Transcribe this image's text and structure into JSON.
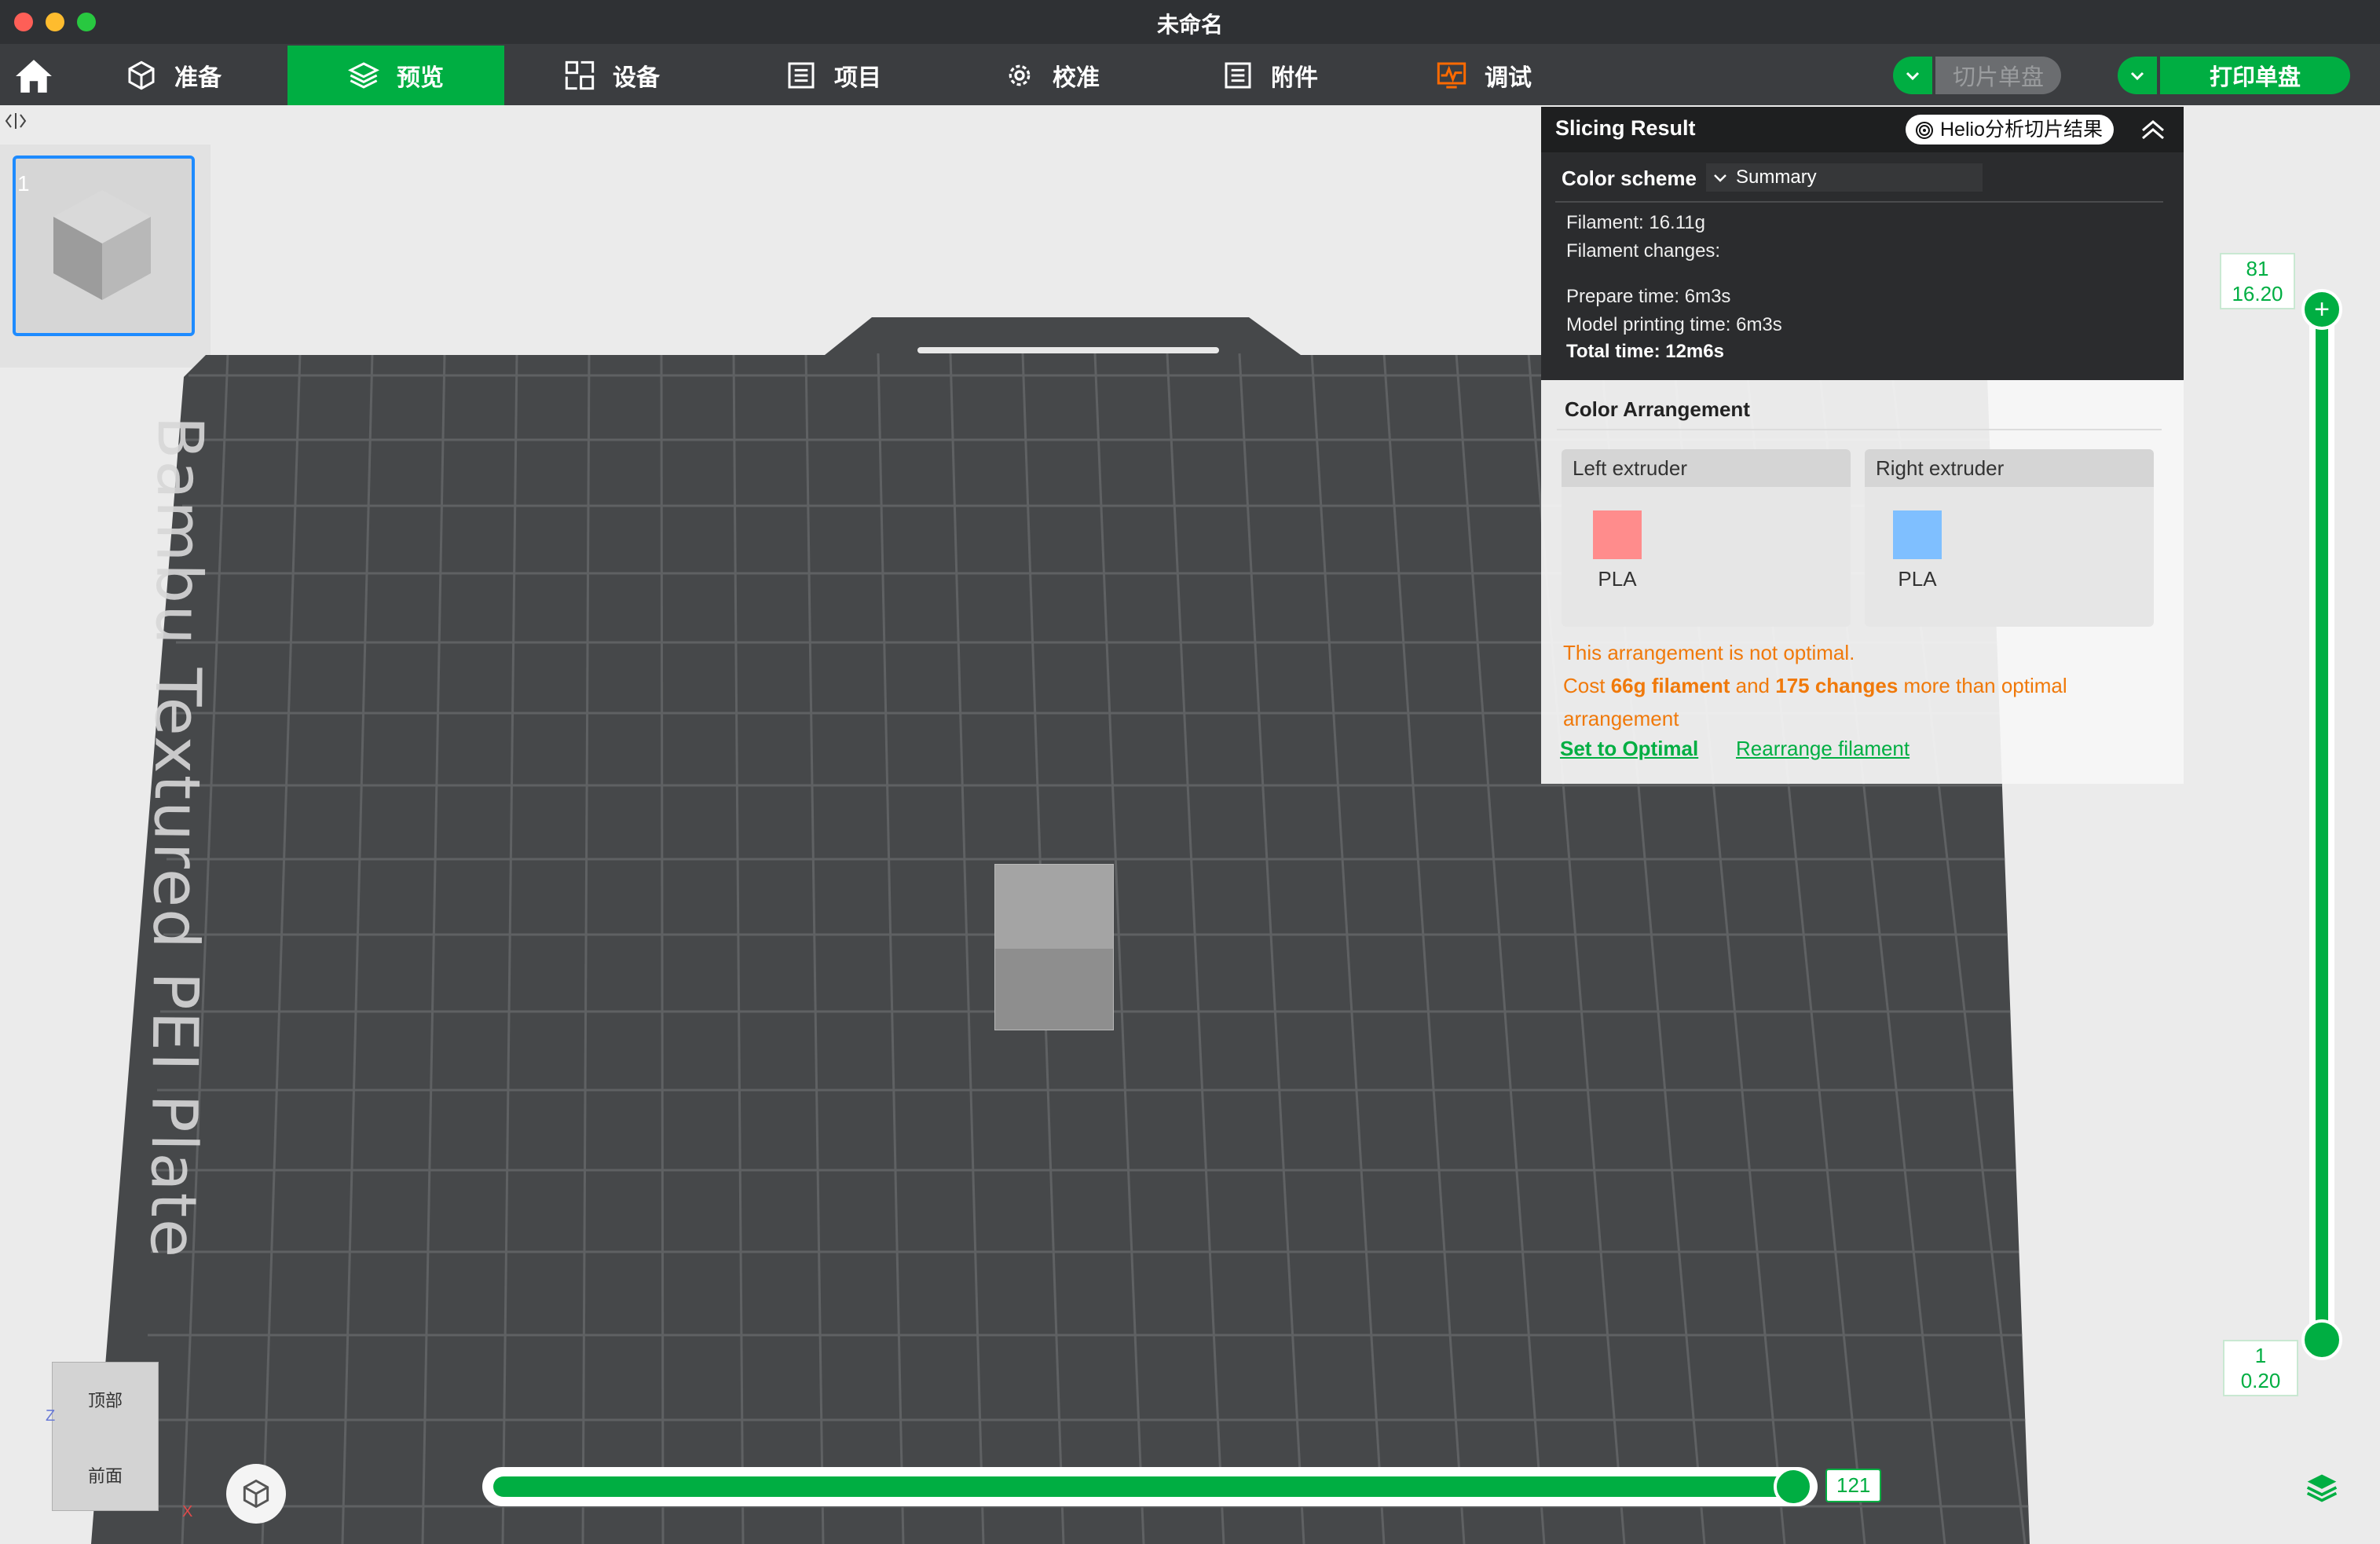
{
  "window": {
    "title": "未命名"
  },
  "toolbar": {
    "tabs": [
      {
        "label": "准备"
      },
      {
        "label": "预览"
      },
      {
        "label": "设备"
      },
      {
        "label": "项目"
      },
      {
        "label": "校准"
      },
      {
        "label": "附件"
      },
      {
        "label": "调试"
      }
    ],
    "slice_label": "切片单盘",
    "print_label": "打印单盘",
    "accent_color": "#00ae42"
  },
  "plate": {
    "number": "1",
    "bed_name": "Bambu Textured PEI Plate"
  },
  "viewcube": {
    "top": "顶部",
    "front": "前面",
    "axis_z": "Z",
    "axis_x": "X"
  },
  "slicing_result": {
    "title": "Slicing Result",
    "helio_label": "Helio分析切片结果",
    "color_scheme_label": "Color scheme",
    "color_scheme_value": "Summary",
    "filament": "Filament:  16.11g",
    "filament_changes": "Filament changes:",
    "prepare_time": "Prepare time:  6m3s",
    "model_printing_time": "Model printing time:  6m3s",
    "total_time": "Total time:  12m6s"
  },
  "color_arrangement": {
    "title": "Color Arrangement",
    "left": {
      "label": "Left  extruder",
      "material": "PLA",
      "color": "#ff8c8c"
    },
    "right": {
      "label": "Right  extruder",
      "material": "PLA",
      "color": "#7fbfff"
    },
    "warning_line1": "This arrangement is not optimal.",
    "warning_cost_prefix": "Cost ",
    "warning_cost_filament": "66g filament",
    "warning_cost_and": " and ",
    "warning_cost_changes": "175 changes",
    "warning_cost_suffix": " more than optimal",
    "warning_line3": "arrangement",
    "set_optimal": "Set to Optimal",
    "rearrange": "Rearrange filament"
  },
  "layer_slider": {
    "top_layer": "81",
    "top_height": "16.20",
    "bottom_layer": "1",
    "bottom_height": "0.20"
  },
  "move_slider": {
    "value": "121"
  }
}
